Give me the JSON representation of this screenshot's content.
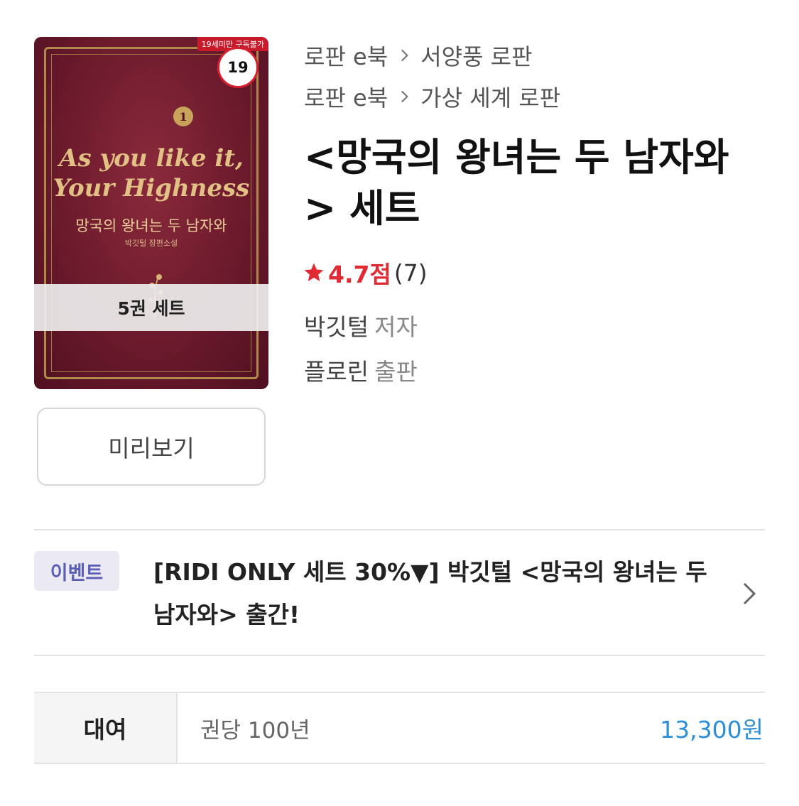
{
  "cover": {
    "age_ribbon": "19세미만 구독불가",
    "age_badge": "19",
    "volume_mark": "1",
    "title_en": "As you like it,\nYour Highness",
    "title_ko": "망국의 왕녀는 두 남자와",
    "author_line": "박깃털 장편소설",
    "set_label": "5권 세트"
  },
  "preview_button": "미리보기",
  "breadcrumbs": [
    {
      "category": "로판 e북",
      "sub": "서양풍 로판"
    },
    {
      "category": "로판 e북",
      "sub": "가상 세계 로판"
    }
  ],
  "title": "<망국의 왕녀는 두 남자와\n> 세트",
  "rating": {
    "score": "4.7점",
    "count": "(7)",
    "color": "#e02b35"
  },
  "author": {
    "name": "박깃털",
    "role": "저자"
  },
  "publisher": {
    "name": "플로린",
    "role": "출판"
  },
  "event": {
    "tag": "이벤트",
    "text": "[RIDI ONLY 세트 30%▼] 박깃털 <망국의 왕녀는 두 남자와> 출간!"
  },
  "rental": {
    "label": "대여",
    "period": "권당 100년",
    "price": "13,300원",
    "price_color": "#2b8fd6"
  },
  "icons": [
    "chevron-right-icon",
    "star-icon",
    "arrow-right-icon"
  ]
}
